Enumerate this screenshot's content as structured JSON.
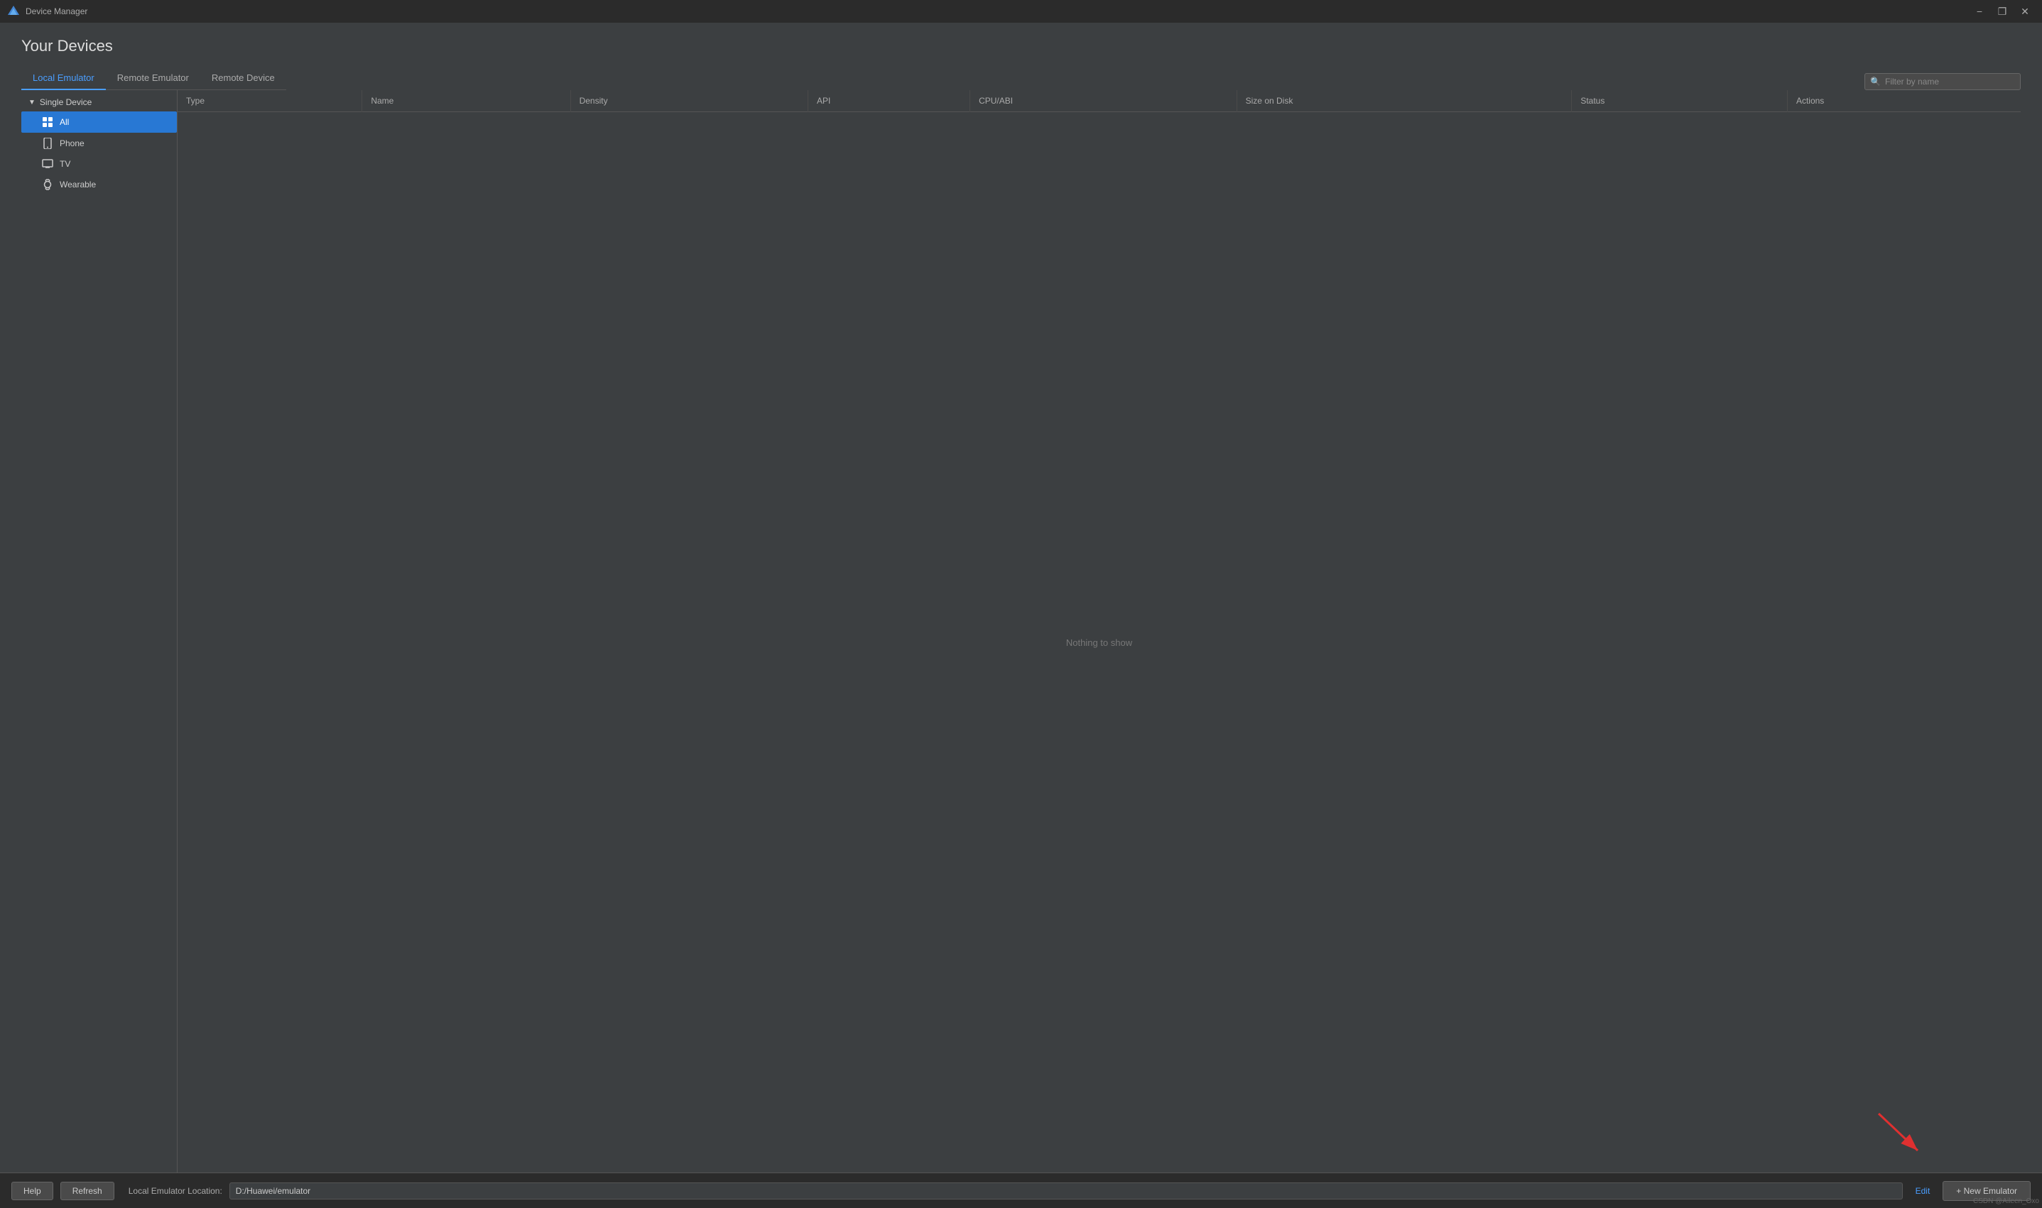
{
  "titleBar": {
    "title": "Device Manager",
    "minimize": "−",
    "maximize": "❐",
    "close": "✕"
  },
  "page": {
    "title": "Your Devices"
  },
  "tabs": [
    {
      "id": "local",
      "label": "Local Emulator",
      "active": true
    },
    {
      "id": "remote",
      "label": "Remote Emulator",
      "active": false
    },
    {
      "id": "remoteDevice",
      "label": "Remote Device",
      "active": false
    }
  ],
  "filter": {
    "placeholder": "Filter by name"
  },
  "sidebar": {
    "sections": [
      {
        "id": "single-device",
        "label": "Single Device",
        "expanded": true,
        "items": [
          {
            "id": "all",
            "label": "All",
            "icon": "⊞",
            "active": true
          },
          {
            "id": "phone",
            "label": "Phone",
            "icon": "📱",
            "active": false
          },
          {
            "id": "tv",
            "label": "TV",
            "icon": "🖥",
            "active": false
          },
          {
            "id": "wearable",
            "label": "Wearable",
            "icon": "⌚",
            "active": false
          }
        ]
      }
    ]
  },
  "table": {
    "columns": [
      {
        "id": "type",
        "label": "Type"
      },
      {
        "id": "name",
        "label": "Name"
      },
      {
        "id": "density",
        "label": "Density"
      },
      {
        "id": "api",
        "label": "API"
      },
      {
        "id": "cpuAbi",
        "label": "CPU/ABI"
      },
      {
        "id": "sizeOnDisk",
        "label": "Size on Disk"
      },
      {
        "id": "status",
        "label": "Status"
      },
      {
        "id": "actions",
        "label": "Actions"
      }
    ],
    "emptyMessage": "Nothing to show"
  },
  "footer": {
    "helpLabel": "Help",
    "refreshLabel": "Refresh",
    "locationLabel": "Local Emulator Location:",
    "locationValue": "D:/Huawei/emulator",
    "editLabel": "Edit",
    "newEmulatorLabel": "+ New Emulator"
  }
}
